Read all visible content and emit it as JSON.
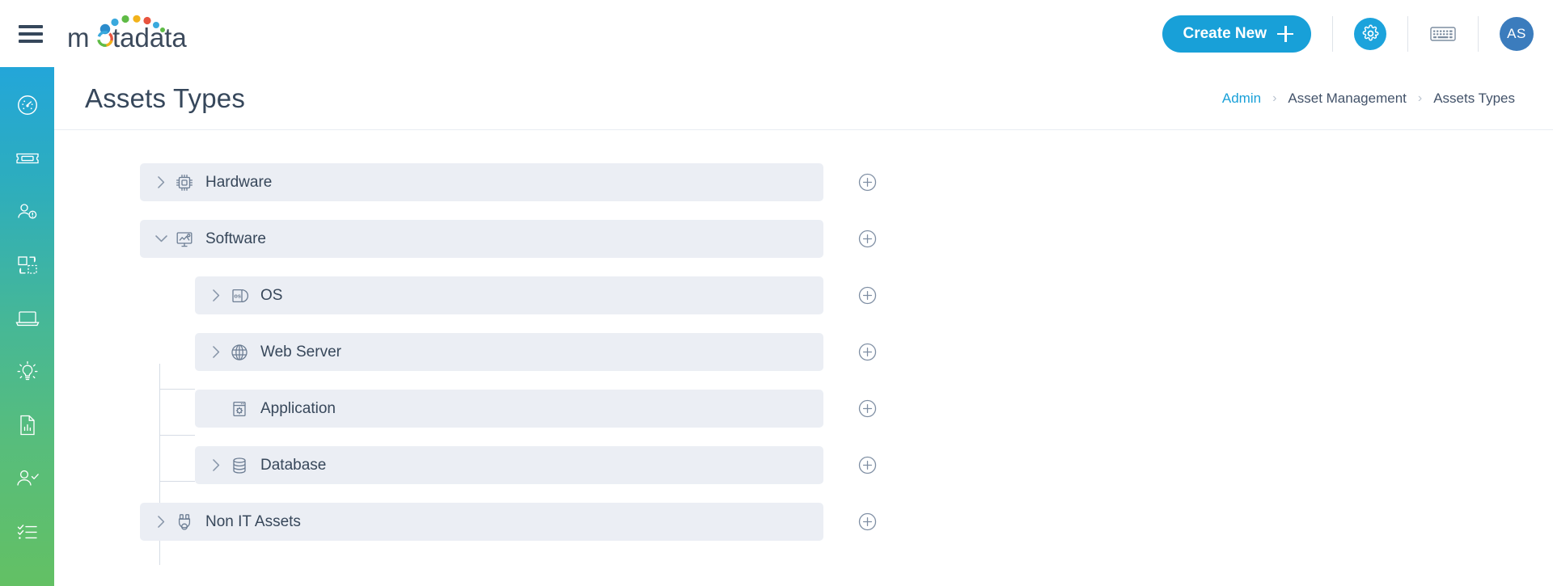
{
  "topbar": {
    "menu_icon": "hamburger-icon",
    "logo_text": "motadata",
    "create_new_label": "Create New",
    "gear_icon": "gear-icon",
    "keyboard_icon": "keyboard-icon",
    "avatar_initials": "AS",
    "accent_color": "#18a0d8",
    "avatar_color": "#3b7cbd"
  },
  "sidebar": {
    "gradient_top": "#23a6d9",
    "gradient_bottom": "#63c064",
    "items": [
      {
        "name": "dashboard-icon",
        "label": "Dashboard"
      },
      {
        "name": "ticket-icon",
        "label": "Tickets"
      },
      {
        "name": "user-alert-icon",
        "label": "Problems"
      },
      {
        "name": "change-icon",
        "label": "Changes"
      },
      {
        "name": "asset-icon",
        "label": "Assets"
      },
      {
        "name": "knowledge-icon",
        "label": "Solutions"
      },
      {
        "name": "report-icon",
        "label": "Reports"
      },
      {
        "name": "user-check-icon",
        "label": "Approvals"
      },
      {
        "name": "tasklist-icon",
        "label": "Tasks"
      }
    ]
  },
  "page": {
    "title": "Assets Types",
    "breadcrumb": [
      {
        "label": "Admin",
        "link": true
      },
      {
        "label": "Asset Management",
        "link": false
      },
      {
        "label": "Assets Types",
        "link": false
      }
    ],
    "breadcrumb_separator": "›"
  },
  "tree": {
    "add_button_label": "Add",
    "row_background": "#ebeef4",
    "nodes": [
      {
        "label": "Hardware",
        "level": 0,
        "icon": "cpu-chip-icon",
        "expandable": true,
        "expanded": false
      },
      {
        "label": "Software",
        "level": 0,
        "icon": "monitor-software-icon",
        "expandable": true,
        "expanded": true
      },
      {
        "label": "OS",
        "level": 1,
        "icon": "os-disc-icon",
        "expandable": true,
        "expanded": false
      },
      {
        "label": "Web Server",
        "level": 1,
        "icon": "globe-icon",
        "expandable": true,
        "expanded": false
      },
      {
        "label": "Application",
        "level": 1,
        "icon": "application-window-icon",
        "expandable": false,
        "expanded": false
      },
      {
        "label": "Database",
        "level": 1,
        "icon": "database-cylinder-icon",
        "expandable": true,
        "expanded": false
      },
      {
        "label": "Non IT Assets",
        "level": 0,
        "icon": "plug-icon",
        "expandable": true,
        "expanded": false
      }
    ]
  }
}
